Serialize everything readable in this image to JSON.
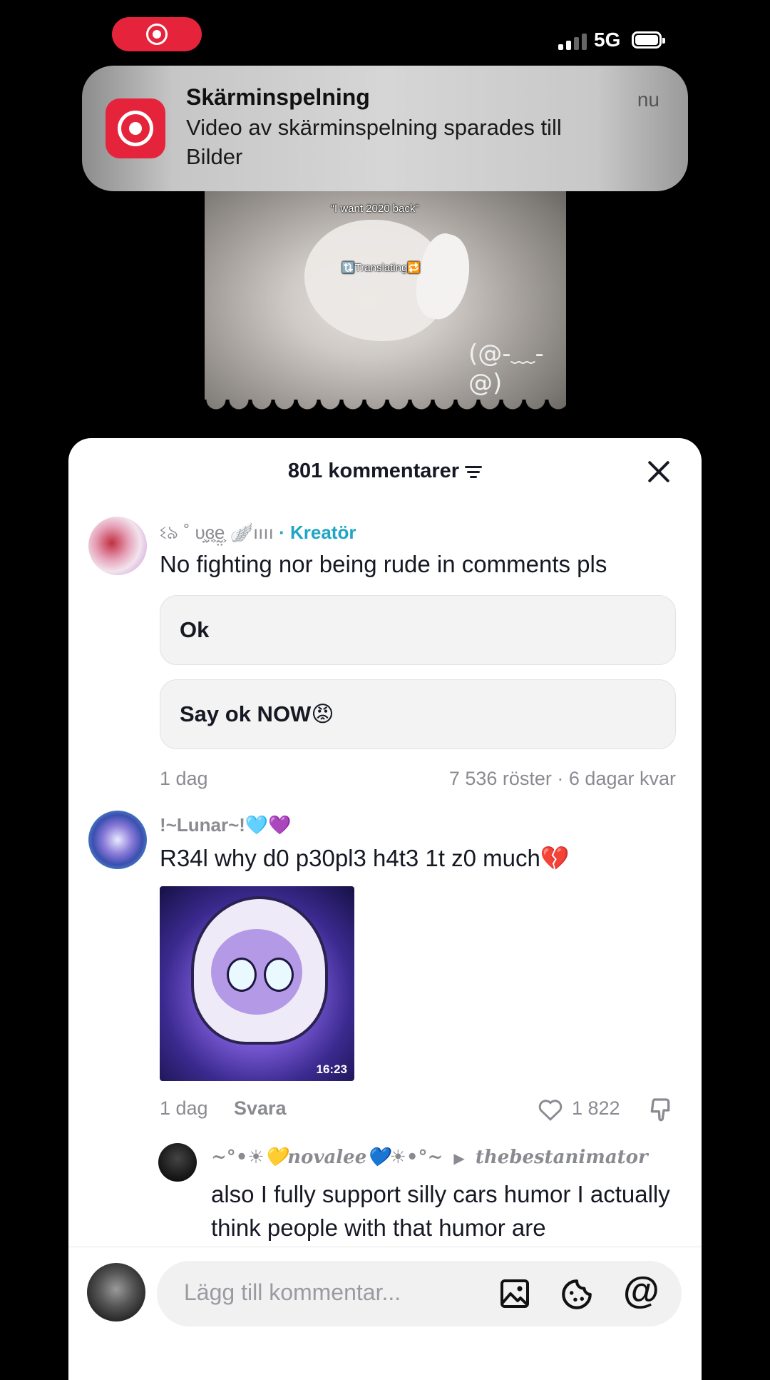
{
  "status_bar": {
    "network": "5G"
  },
  "notification": {
    "app": "Skärminspelning",
    "message": "Video av skärminspelning sparades till Bilder",
    "time": "nu"
  },
  "video": {
    "caption_top": "“I want 2020 back”",
    "caption_mid": "🔃Translating🔁",
    "face": "(@-﹏-@)"
  },
  "comments_sheet": {
    "header": "801 kommentarer",
    "pinned": {
      "username": "ଽ৯ ˚ υ̤͕ɞ̤͕ḛ̤͕ 🪽ıııı",
      "creator_label": "· Kreatör",
      "text": "No fighting nor being rude in comments pls",
      "poll_options": [
        "Ok",
        "Say ok NOW😡"
      ],
      "age": "1 dag",
      "poll_meta": "7 536 röster · 6 dagar kvar"
    },
    "comment": {
      "username": "!~Lunar~!🩵💜",
      "text": "R34l why d0 p30pl3 h4t3 1t z0 much💔",
      "thumbnail_duration": "16:23",
      "age": "1 dag",
      "reply_label": "Svara",
      "likes": "1 822"
    },
    "reply": {
      "username": "~°•☀︎💛novalee💙☀︎•°~",
      "replying_to": "thebestanimator",
      "text": "also I fully support silly cars humor I actually think people with that humor are"
    },
    "input": {
      "placeholder": "Lägg till kommentar..."
    }
  },
  "colors": {
    "accent": "#20a5c4",
    "recording": "#e5243b"
  }
}
